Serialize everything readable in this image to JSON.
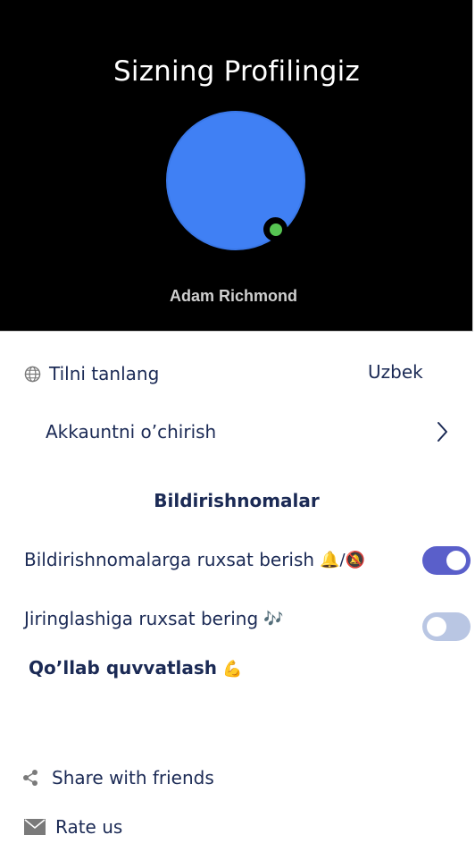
{
  "header": {
    "title": "Sizning Profilingiz",
    "username": "Adam Richmond",
    "avatar_color": "#4080f4",
    "status_color": "#57c552"
  },
  "settings": {
    "language_label": "Tilni tanlang",
    "language_value": "Uzbek",
    "language_icon": "globe-icon",
    "delete_account_label": "Akkauntni o’chirish",
    "delete_account_icon": "chevron-right-icon"
  },
  "notifications": {
    "section_title": "Bildirishnomalar",
    "allow_notifications_label": "Bildirishnomalarga ruxsat berish",
    "allow_notifications_emoji": "🔔/🔕",
    "allow_notifications_on": true,
    "allow_ringing_label": "Jiringlashiga ruxsat bering",
    "allow_ringing_emoji": "🎶",
    "allow_ringing_on": false,
    "toggle_on_color": "#5a5fca",
    "toggle_off_color": "#b9c6e3"
  },
  "support": {
    "title": "Qo’llab quvvatlash",
    "emoji": "💪",
    "share_label": "Share with friends",
    "share_icon": "share-icon",
    "rate_label": "Rate us",
    "rate_icon": "mail-icon"
  }
}
